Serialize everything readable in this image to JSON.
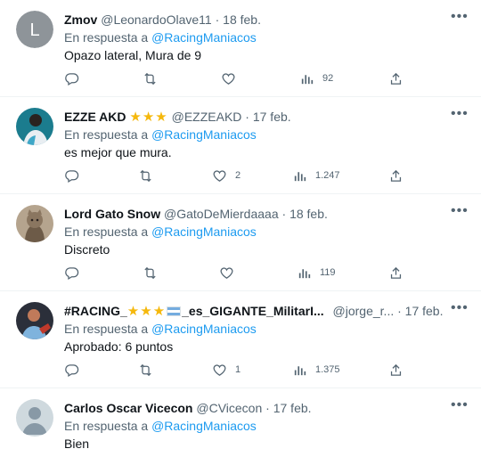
{
  "reply_prefix": "En respuesta a",
  "tweets": [
    {
      "name": "Zmov",
      "handle": "@LeonardoOlave11",
      "date": "18 feb.",
      "reply_to": "@RacingManiacos",
      "text": "Opazo lateral, Mura de 9",
      "stars": "",
      "replies": "",
      "retweets": "",
      "likes": "",
      "views": "92",
      "avatar": {
        "type": "letter",
        "letter": "L",
        "color": "#8e9499"
      }
    },
    {
      "name": "EZZE AKD",
      "handle": "@EZZEAKD",
      "date": "17 feb.",
      "reply_to": "@RacingManiacos",
      "text": "es mejor que mura.",
      "stars": "★★★",
      "replies": "",
      "retweets": "",
      "likes": "2",
      "views": "1.247",
      "avatar": {
        "type": "photo",
        "color": "#1b7c8e"
      }
    },
    {
      "name": "Lord Gato Snow",
      "handle": "@GatoDeMierdaaaa",
      "date": "18 feb.",
      "reply_to": "@RacingManiacos",
      "text": "Discreto",
      "stars": "",
      "replies": "",
      "retweets": "",
      "likes": "",
      "views": "119",
      "avatar": {
        "type": "photo",
        "color": "#6d5b48"
      }
    },
    {
      "name_a": "#RACING_",
      "stars": "★★★",
      "name_b": "_es_GIGANTE_MilitarI...",
      "handle": "@jorge_r...",
      "date": "17 feb.",
      "reply_to": "@RacingManiacos",
      "text": "Aprobado: 6 puntos",
      "replies": "",
      "retweets": "",
      "likes": "1",
      "views": "1.375",
      "avatar": {
        "type": "photo",
        "color": "#2b2f3a"
      }
    },
    {
      "name": "Carlos Oscar Vicecon",
      "handle": "@CVicecon",
      "date": "17 feb.",
      "reply_to": "@RacingManiacos",
      "text": "Bien",
      "stars": "",
      "replies": "",
      "retweets": "",
      "likes": "",
      "views": "",
      "avatar": {
        "type": "default",
        "color": "#cfd9de"
      }
    }
  ],
  "colors": {
    "accent": "#1d9bf0",
    "muted": "#536471",
    "star": "#f5b80c"
  }
}
